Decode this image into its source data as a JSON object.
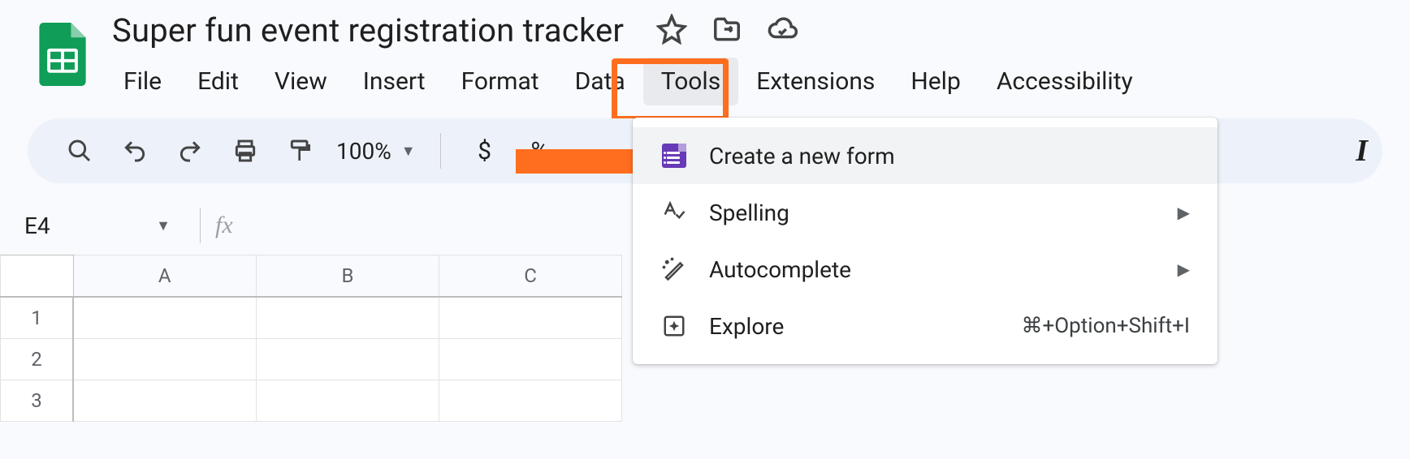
{
  "doc": {
    "title": "Super fun event registration tracker"
  },
  "menubar": {
    "file": "File",
    "edit": "Edit",
    "view": "View",
    "insert": "Insert",
    "format": "Format",
    "data": "Data",
    "tools": "Tools",
    "extensions": "Extensions",
    "help": "Help",
    "accessibility": "Accessibility"
  },
  "toolbar": {
    "zoom": "100%",
    "currency": "$",
    "percent": "%"
  },
  "dropdown": {
    "create_form": "Create a new form",
    "spelling": "Spelling",
    "autocomplete": "Autocomplete",
    "explore": "Explore",
    "explore_shortcut": "⌘+Option+Shift+I"
  },
  "namebox": {
    "cell": "E4"
  },
  "grid": {
    "col_a": "A",
    "col_b": "B",
    "col_c": "C",
    "row_1": "1",
    "row_2": "2",
    "row_3": "3"
  }
}
